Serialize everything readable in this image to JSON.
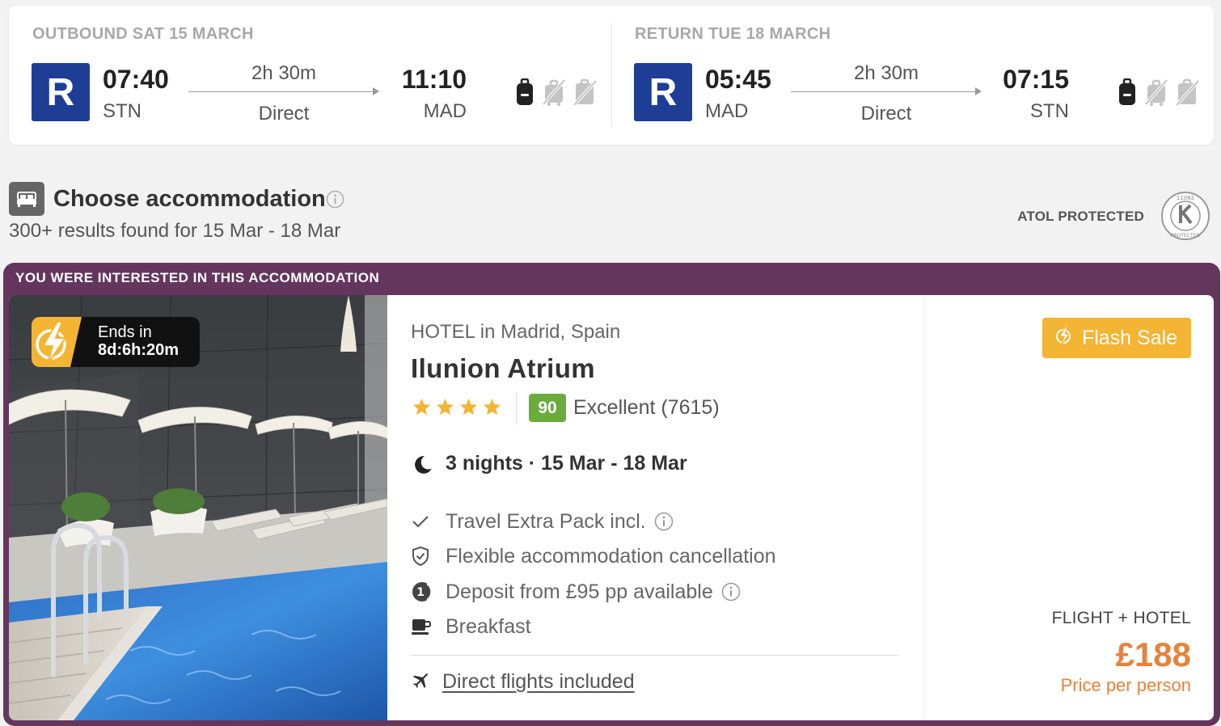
{
  "outbound": {
    "title": "OUTBOUND SAT 15 MARCH",
    "airline_logo": "R",
    "dep_time": "07:40",
    "dep_code": "STN",
    "duration": "2h 30m",
    "stops": "Direct",
    "arr_time": "11:10",
    "arr_code": "MAD",
    "baggage_icons": [
      "cabin-bag-icon",
      "no-checked-bag-icon",
      "no-hold-bag-icon"
    ]
  },
  "return": {
    "title": "RETURN TUE 18 MARCH",
    "airline_logo": "R",
    "dep_time": "05:45",
    "dep_code": "MAD",
    "duration": "2h 30m",
    "stops": "Direct",
    "arr_time": "07:15",
    "arr_code": "STN",
    "baggage_icons": [
      "cabin-bag-icon",
      "no-checked-bag-icon",
      "no-hold-bag-icon"
    ]
  },
  "section": {
    "title": "Choose accommodation",
    "results": "300+ results found for 15 Mar - 18 Mar",
    "atol": "ATOL PROTECTED",
    "atol_number": "11082"
  },
  "accommodation": {
    "banner": "YOU WERE INTERESTED IN THIS ACCOMMODATION",
    "countdown_label": "Ends in",
    "countdown_value": "8d:6h:20m",
    "type": "HOTEL in Madrid, Spain",
    "name": "Ilunion Atrium",
    "stars": 4,
    "score": "90",
    "score_text": "Excellent (7615)",
    "nights": "3 nights · 15 Mar - 18 Mar",
    "features": [
      "Travel Extra Pack incl.",
      "Flexible accommodation cancellation",
      "Deposit from £95 pp available",
      "Breakfast"
    ],
    "flights_link": "Direct flights included",
    "flash_sale": "Flash Sale",
    "package_label": "FLIGHT + HOTEL",
    "price": "£188",
    "price_sub": "Price per person"
  },
  "colors": {
    "airline": "#1e3e96",
    "banner": "#64365e",
    "flash": "#f4b434",
    "price": "#e8823a",
    "score": "#6aac3c"
  }
}
